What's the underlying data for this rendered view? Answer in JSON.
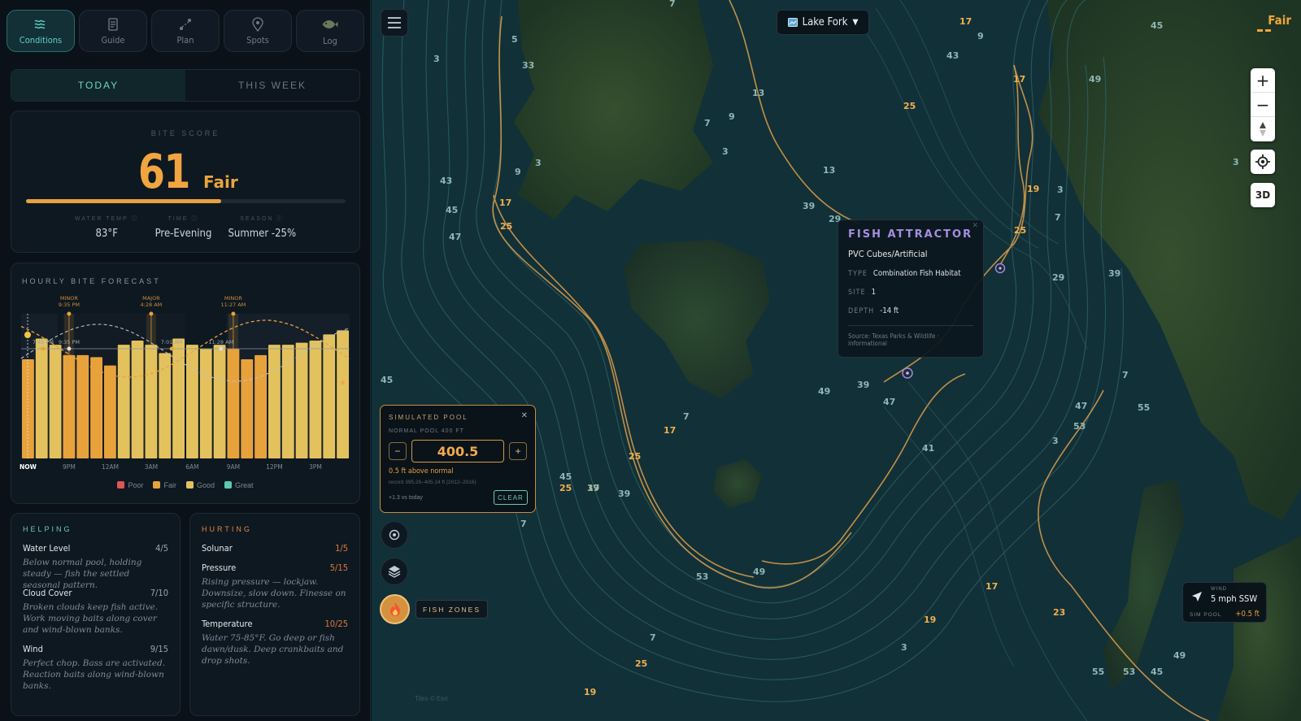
{
  "nav": [
    {
      "label": "Conditions",
      "icon": "waves-icon",
      "active": true
    },
    {
      "label": "Guide",
      "icon": "book-icon",
      "active": false
    },
    {
      "label": "Plan",
      "icon": "route-icon",
      "active": false
    },
    {
      "label": "Spots",
      "icon": "pin-icon",
      "active": false
    },
    {
      "label": "Log",
      "icon": "fish-icon",
      "active": false
    }
  ],
  "tabs": {
    "today": "TODAY",
    "week": "THIS WEEK"
  },
  "bite": {
    "label": "BITE SCORE",
    "score": "61",
    "rating": "Fair",
    "progress": 0.61,
    "meta": [
      {
        "label": "WATER TEMP ⓘ",
        "value": "83°F"
      },
      {
        "label": "TIME ⓘ",
        "value": "Pre-Evening"
      },
      {
        "label": "SEASON ⓘ",
        "value": "Summer -25%"
      }
    ]
  },
  "forecast": {
    "title": "HOURLY BITE FORECAST",
    "legend": [
      {
        "label": "Poor",
        "color": "#e05555"
      },
      {
        "label": "Fair",
        "color": "#e8a23c"
      },
      {
        "label": "Good",
        "color": "#e3c25e"
      },
      {
        "label": "Great",
        "color": "#5bc8b4"
      }
    ]
  },
  "chart_data": {
    "type": "bar",
    "title": "HOURLY BITE FORECAST",
    "categories": [
      "NOW",
      "",
      "",
      "9PM",
      "",
      "",
      "12AM",
      "",
      "",
      "3AM",
      "",
      "",
      "6AM",
      "",
      "",
      "9AM",
      "",
      "",
      "12PM",
      "",
      "",
      "3PM",
      "",
      ""
    ],
    "values": [
      48,
      58,
      55,
      50,
      50,
      49,
      45,
      55,
      57,
      55,
      51,
      58,
      55,
      53,
      55,
      53,
      48,
      50,
      55,
      55,
      56,
      57,
      60,
      62
    ],
    "ratings": [
      "fair",
      "good",
      "good",
      "fair",
      "fair",
      "fair",
      "fair",
      "good",
      "good",
      "good",
      "good",
      "good",
      "good",
      "good",
      "good",
      "fair",
      "fair",
      "fair",
      "good",
      "good",
      "good",
      "good",
      "good",
      "good"
    ],
    "x_tick_labels": [
      "NOW",
      "9PM",
      "12AM",
      "3AM",
      "6AM",
      "9AM",
      "12PM",
      "3PM"
    ],
    "ylim": [
      0,
      70
    ],
    "periods": [
      {
        "type": "MINOR",
        "time": "9:35 PM"
      },
      {
        "type": "MAJOR",
        "time": "4:28 AM"
      },
      {
        "type": "MINOR",
        "time": "11:27 AM"
      }
    ],
    "event_times": [
      "7:45 PM",
      "9:35 PM",
      "7:01 AM",
      "11:28 AM"
    ],
    "best_marker": "★"
  },
  "helping": {
    "title": "HELPING",
    "items": [
      {
        "name": "Water Level",
        "score": "4/5",
        "desc": "Below normal pool, holding steady — fish the settled seasonal pattern."
      },
      {
        "name": "Cloud Cover",
        "score": "7/10",
        "desc": "Broken clouds keep fish active. Work moving baits along cover and wind-blown banks."
      },
      {
        "name": "Wind",
        "score": "9/15",
        "desc": "Perfect chop. Bass are activated. Reaction baits along wind-blown banks."
      }
    ]
  },
  "hurting": {
    "title": "HURTING",
    "items": [
      {
        "name": "Solunar",
        "score": "1/5",
        "desc": ""
      },
      {
        "name": "Pressure",
        "score": "5/15",
        "desc": "Rising pressure — lockjaw. Downsize, slow down. Finesse on specific structure."
      },
      {
        "name": "Temperature",
        "score": "10/25",
        "desc": "Water 75-85°F. Go deep or fish dawn/dusk. Deep crankbaits and drop shots."
      }
    ]
  },
  "map": {
    "lake": "Lake Fork",
    "rating": "Fair",
    "controls": {
      "zoom_in": "+",
      "zoom_out": "−",
      "compass": "▲",
      "locate": "locate-icon",
      "three_d": "3D"
    },
    "attribution": "Tiles © Esri",
    "popup": {
      "title": "FISH ATTRACTOR",
      "subtitle": "PVC Cubes/Artificial",
      "type_label": "TYPE",
      "type_value": "Combination Fish Habitat",
      "site_label": "SITE",
      "site_value": "1",
      "depth_label": "DEPTH",
      "depth_value": "-14 ft",
      "source": "Source: Texas Parks & Wildlife · informational"
    },
    "sim_pool": {
      "title": "SIMULATED POOL",
      "normal": "NORMAL POOL 400 FT",
      "minus": "−",
      "plus": "+",
      "value": "400.5",
      "above": "0.5 ft above normal",
      "record": "record 395.26–405.14 ft (2012–2016)",
      "today": "+1.3 vs today",
      "clear": "CLEAR"
    },
    "fish_zones": "FISH ZONES",
    "wind": {
      "label": "WIND",
      "value": "5 mph SSW",
      "pool_label": "SIM POOL",
      "pool_value": "+0.5 ft"
    },
    "depth_labels": [
      "7",
      "5",
      "3",
      "33",
      "13",
      "9",
      "7",
      "3",
      "9",
      "3",
      "43",
      "45",
      "47",
      "17",
      "25",
      "13",
      "39",
      "29",
      "25",
      "43",
      "17",
      "25",
      "19",
      "3",
      "7",
      "3",
      "7",
      "45",
      "49",
      "39",
      "47",
      "41",
      "47",
      "53",
      "3",
      "7",
      "17",
      "25",
      "39",
      "25",
      "17",
      "7",
      "45",
      "39",
      "53",
      "49",
      "17",
      "23",
      "19",
      "3",
      "7",
      "25",
      "19",
      "49",
      "45",
      "55",
      "53",
      "45",
      "49",
      "55",
      "39",
      "29",
      "17",
      "9",
      "3"
    ]
  }
}
